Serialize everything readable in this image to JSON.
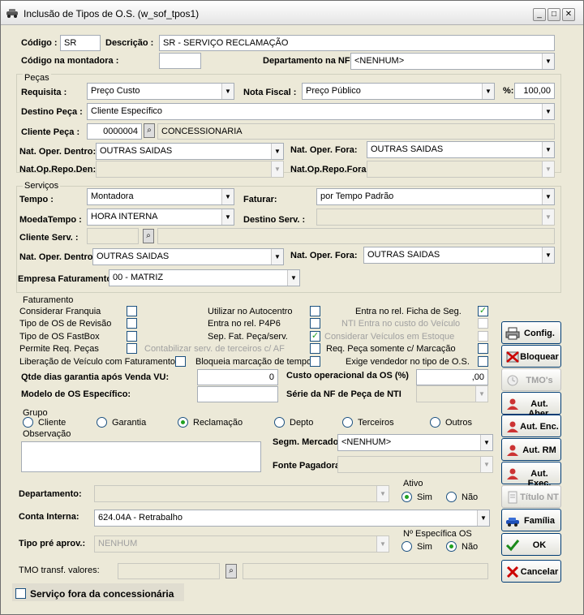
{
  "window": {
    "title": "Inclusão de Tipos de O.S. (w_sof_tpos1)"
  },
  "header": {
    "codigo_label": "Código :",
    "codigo_value": "SR",
    "descricao_label": "Descrição :",
    "descricao_value": "SR - SERVIÇO RECLAMAÇÃO",
    "cod_montadora_label": "Código na montadora :",
    "cod_montadora_value": "",
    "depto_nf_label": "Departamento na NF:",
    "depto_nf_value": "<NENHUM>"
  },
  "pecas": {
    "title": "Peças",
    "requisita_label": "Requisita :",
    "requisita_value": "Preço Custo",
    "nota_fiscal_label": "Nota Fiscal :",
    "nota_fiscal_value": "Preço Público",
    "pct_label": "%:",
    "pct_value": "100,00",
    "destino_label": "Destino Peça :",
    "destino_value": "Cliente Específico",
    "cliente_label": "Cliente Peça :",
    "cliente_code": "0000004",
    "cliente_name": "CONCESSIONARIA",
    "nat_dentro_label": "Nat. Oper. Dentro:",
    "nat_dentro_value": "OUTRAS SAIDAS",
    "nat_fora_label": "Nat. Oper. Fora:",
    "nat_fora_value": "OUTRAS SAIDAS",
    "repo_den_label": "Nat.Op.Repo.Den:",
    "repo_den_value": "",
    "repo_fora_label": "Nat.Op.Repo.Fora:",
    "repo_fora_value": ""
  },
  "servicos": {
    "title": "Serviços",
    "tempo_label": "Tempo :",
    "tempo_value": "Montadora",
    "faturar_label": "Faturar:",
    "faturar_value": "por Tempo Padrão",
    "moeda_label": "MoedaTempo :",
    "moeda_value": "HORA  INTERNA",
    "destino_label": "Destino Serv. :",
    "destino_value": "",
    "cliente_label": "Cliente Serv. :",
    "cliente_code": "",
    "cliente_name": "",
    "nat_dentro_label": "Nat. Oper. Dentro:",
    "nat_dentro_value": "OUTRAS SAIDAS",
    "nat_fora_label": "Nat. Oper. Fora:",
    "nat_fora_value": "OUTRAS SAIDAS",
    "empresa_label": "Empresa Faturamento:",
    "empresa_value": "00 - MATRIZ"
  },
  "faturamento": {
    "title": "Faturamento",
    "col1": [
      {
        "label": "Considerar Franquia",
        "checked": false
      },
      {
        "label": "Tipo de OS de Revisão",
        "checked": false
      },
      {
        "label": "Tipo de OS FastBox",
        "checked": false
      },
      {
        "label": "Permite Req. Peças",
        "checked": false
      }
    ],
    "col2": [
      {
        "label": "Utilizar no Autocentro",
        "checked": false
      },
      {
        "label": "Entra no rel. P4P6",
        "checked": false
      },
      {
        "label": "Sep. Fat. Peça/serv.",
        "checked": true
      },
      {
        "label": "Contabilizar serv. de terceiros c/ AF",
        "checked": false
      }
    ],
    "col3": [
      {
        "label": "Entra no rel. Ficha de Seg.",
        "checked": true
      },
      {
        "label": "NTI Entra no custo do Veículo",
        "checked": false
      },
      {
        "label": "Considerar Veículos em Estoque",
        "checked": false
      },
      {
        "label": "Req. Peça somente c/ Marcação",
        "checked": false
      }
    ],
    "liberacao_label": "Liberação de Veículo com Faturamento",
    "bloqueia_label": "Bloqueia marcação de tempo",
    "exige_label": "Exige vendedor no tipo de O.S.",
    "qtde_label": "Qtde dias garantia após Venda VU:",
    "qtde_value": "0",
    "custo_label": "Custo operacional da OS (%)",
    "custo_value": ",00",
    "modelo_label": "Modelo de OS Específico:",
    "modelo_value": "",
    "serie_label": "Série da NF de Peça de NTI",
    "serie_value": ""
  },
  "grupo": {
    "title": "Grupo",
    "options": [
      "Cliente",
      "Garantia",
      "Reclamação",
      "Depto",
      "Terceiros",
      "Outros"
    ],
    "selected": "Reclamação"
  },
  "obs": {
    "label": "Observação",
    "value": ""
  },
  "segm": {
    "label": "Segm. Mercado:",
    "value": "<NENHUM>"
  },
  "fonte": {
    "label": "Fonte Pagadora:",
    "value": ""
  },
  "departamento": {
    "label": "Departamento:",
    "value": ""
  },
  "ativo": {
    "title": "Ativo",
    "sim": "Sim",
    "nao": "Não",
    "selected": "Sim"
  },
  "conta": {
    "label": "Conta Interna:",
    "value": "624.04A - Retrabalho"
  },
  "tipo_pre": {
    "label": "Tipo pré aprov.:",
    "value": "NENHUM"
  },
  "n_especifica": {
    "title": "Nº Específica OS",
    "sim": "Sim",
    "nao": "Não",
    "selected": "Não"
  },
  "tmo": {
    "label": "TMO transf. valores:",
    "code": "",
    "name": ""
  },
  "fora": {
    "label": "Serviço fora da concessionária"
  },
  "buttons": [
    {
      "label": "Config.",
      "icon": "printer-icon",
      "enabled": true
    },
    {
      "label": "Bloquear",
      "icon": "block-icon",
      "enabled": true
    },
    {
      "label": "TMO's",
      "icon": "clock-icon",
      "enabled": false
    },
    {
      "label": "Aut. Aber.",
      "icon": "user-icon",
      "enabled": true
    },
    {
      "label": "Aut. Enc.",
      "icon": "user-icon",
      "enabled": true
    },
    {
      "label": "Aut. RM",
      "icon": "user-icon",
      "enabled": true
    },
    {
      "label": "Aut. Exec.",
      "icon": "user-icon",
      "enabled": true
    },
    {
      "label": "Título NT",
      "icon": "document-icon",
      "enabled": false
    },
    {
      "label": "Família",
      "icon": "car-icon",
      "enabled": true
    },
    {
      "label": "OK",
      "icon": "check-icon",
      "enabled": true
    },
    {
      "label": "Cancelar",
      "icon": "cancel-icon",
      "enabled": true
    }
  ]
}
